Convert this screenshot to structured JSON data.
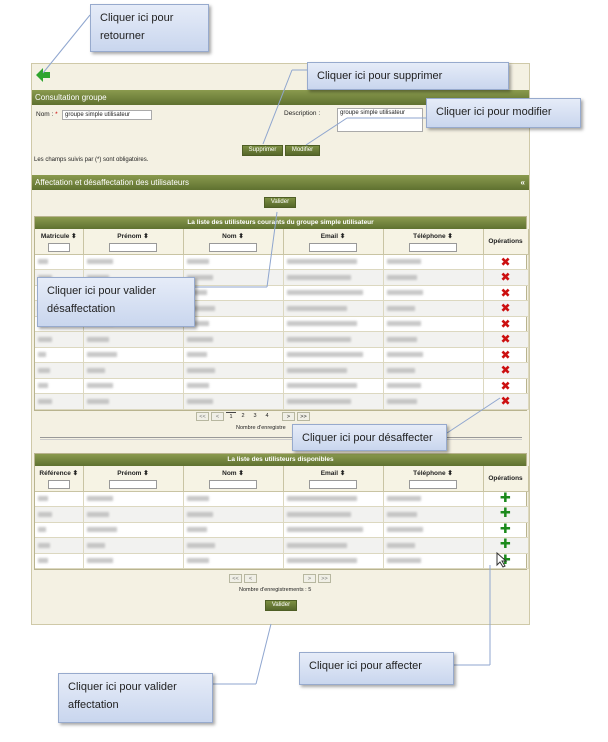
{
  "callouts": {
    "retourner": "Cliquer ici pour retourner",
    "supprimer": "Cliquer ici pour supprimer",
    "modifier": "Cliquer ici pour modifier",
    "valider_desaffectation": "Cliquer ici pour valider désaffectation",
    "desaffecter": "Cliquer ici pour désaffecter",
    "affecter": "Cliquer ici pour affecter",
    "valider_affectation": "Cliquer ici pour valider affectation"
  },
  "consultation": {
    "header": "Consultation groupe",
    "nom_label": "Nom :",
    "required_mark": "*",
    "nom_value": "groupe simple utilisateur",
    "description_label": "Description :",
    "description_value": "groupe simple utilisateur",
    "delete_button": "Supprimer",
    "modify_button": "Modifier",
    "required_note": "Les champs suivis par (*) sont obligatoires."
  },
  "assignment": {
    "header": "Affectation et désaffectation des utilisateurs",
    "collapse_icon": "«",
    "validate_top": "Valider",
    "validate_bottom": "Valider"
  },
  "current_users": {
    "title": "La liste des utilisteurs courants du groupe simple utilisateur",
    "columns": [
      "Matricule ⬍",
      "Prénom ⬍",
      "Nom ⬍",
      "Email ⬍",
      "Téléphone ⬍",
      "Opérations"
    ],
    "row_count": 10,
    "action_icon": "delete-icon",
    "pager": {
      "first": "<<",
      "prev": "<",
      "pages": [
        "1",
        "2",
        "3",
        "4"
      ],
      "current": "1",
      "next": ">",
      "last": ">>"
    },
    "count_text": "Nombre d'enregistre"
  },
  "available_users": {
    "title": "La liste des utilisteurs disponibles",
    "columns": [
      "Référence ⬍",
      "Prénom ⬍",
      "Nom ⬍",
      "Email ⬍",
      "Téléphone ⬍",
      "Opérations"
    ],
    "row_count": 5,
    "action_icon": "add-icon",
    "pager": {
      "first": "<<",
      "prev": "<",
      "next": ">",
      "last": ">>"
    },
    "count_text": "Nombre d'enregistrements : 5"
  },
  "colors": {
    "header_green": "#6b7d38",
    "delete_red": "#cc1010",
    "add_green": "#1c8a1c",
    "callout_blue": "#d6e0f3"
  }
}
